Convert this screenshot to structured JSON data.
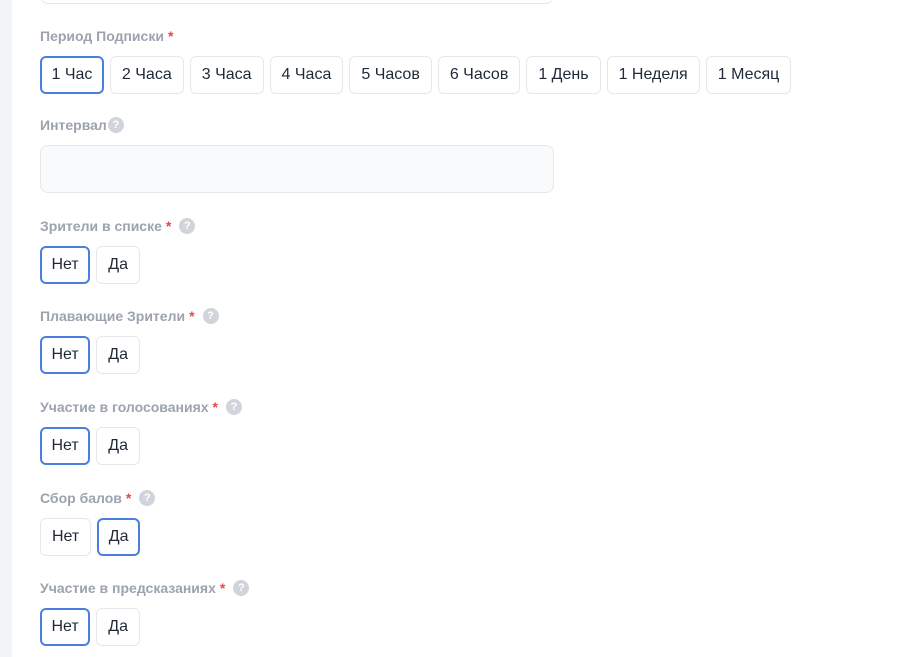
{
  "subscription_period": {
    "label": "Период Подписки",
    "required_mark": "*",
    "options": [
      "1 Час",
      "2 Часа",
      "3 Часа",
      "4 Часа",
      "5 Часов",
      "6 Часов",
      "1 День",
      "1 Неделя",
      "1 Месяц"
    ],
    "selected": "1 Час"
  },
  "interval": {
    "label": "Интервал",
    "help": "?",
    "value": ""
  },
  "viewers_in_list": {
    "label": "Зрители в списке",
    "required_mark": "*",
    "help": "?",
    "no_label": "Нет",
    "yes_label": "Да",
    "selected": "Нет"
  },
  "floating_viewers": {
    "label": "Плавающие Зрители",
    "required_mark": "*",
    "help": "?",
    "no_label": "Нет",
    "yes_label": "Да",
    "selected": "Нет"
  },
  "voting_participation": {
    "label": "Участие в голосованиях",
    "required_mark": "*",
    "help": "?",
    "no_label": "Нет",
    "yes_label": "Да",
    "selected": "Нет"
  },
  "points_collection": {
    "label": "Сбор балов",
    "required_mark": "*",
    "help": "?",
    "no_label": "Нет",
    "yes_label": "Да",
    "selected": "Да"
  },
  "predictions_participation": {
    "label": "Участие в предсказаниях",
    "required_mark": "*",
    "help": "?",
    "no_label": "Нет",
    "yes_label": "Да",
    "selected": "Нет"
  },
  "colors": {
    "active_border": "#4a7fe0",
    "required": "#ef4444",
    "label": "#9ca3af"
  }
}
